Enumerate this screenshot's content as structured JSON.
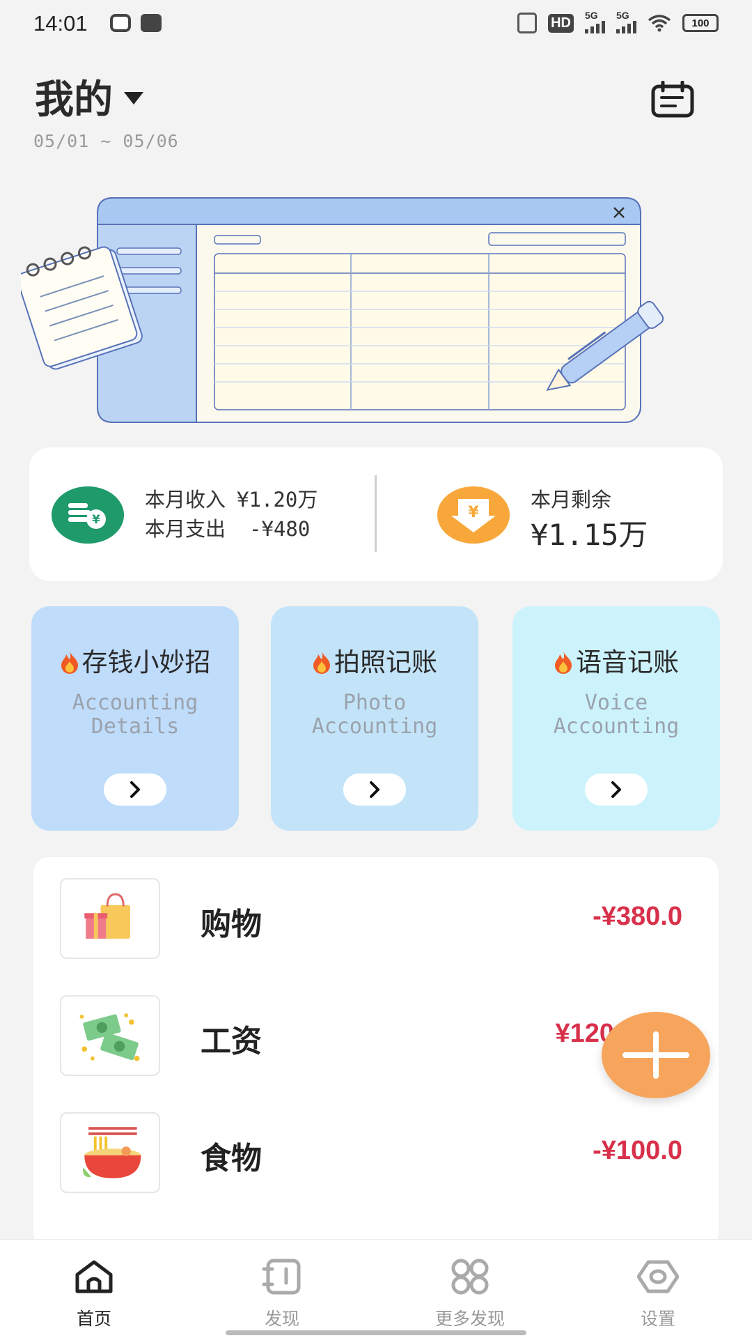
{
  "status": {
    "time": "14:01",
    "hd_label": "HD",
    "signal_label_1": "5G",
    "signal_label_2": "5G",
    "battery": "100"
  },
  "header": {
    "title": "我的",
    "date_range": "05/01 ~ 05/06"
  },
  "summary": {
    "income_label": "本月收入",
    "income_value": "¥1.20万",
    "expense_label": "本月支出",
    "expense_value": "-¥480",
    "balance_label": "本月剩余",
    "balance_value": "¥1.15万"
  },
  "features": [
    {
      "title": "存钱小妙招",
      "subtitle": "Accounting\nDetails",
      "color": "#bfdcfb"
    },
    {
      "title": "拍照记账",
      "subtitle": "Photo\nAccounting",
      "color": "#c3e4f8"
    },
    {
      "title": "语音记账",
      "subtitle": "Voice\nAccounting",
      "color": "#ccf3fb"
    }
  ],
  "records": [
    {
      "name": "购物",
      "amount": "-¥380.0",
      "icon": "shopping-bag-icon"
    },
    {
      "name": "工资",
      "amount": "¥120",
      "icon": "money-icon"
    },
    {
      "name": "食物",
      "amount": "-¥100.0",
      "icon": "noodle-bowl-icon"
    }
  ],
  "nav": [
    {
      "label": "首页",
      "icon": "home-icon",
      "active": true
    },
    {
      "label": "发现",
      "icon": "notebook-icon",
      "active": false
    },
    {
      "label": "更多发现",
      "icon": "grid-icon",
      "active": false
    },
    {
      "label": "设置",
      "icon": "hexagon-eye-icon",
      "active": false
    }
  ],
  "colors": {
    "accent_orange": "#f7a55c",
    "expense_red": "#d8304a",
    "income_green": "#1f9a6b"
  }
}
